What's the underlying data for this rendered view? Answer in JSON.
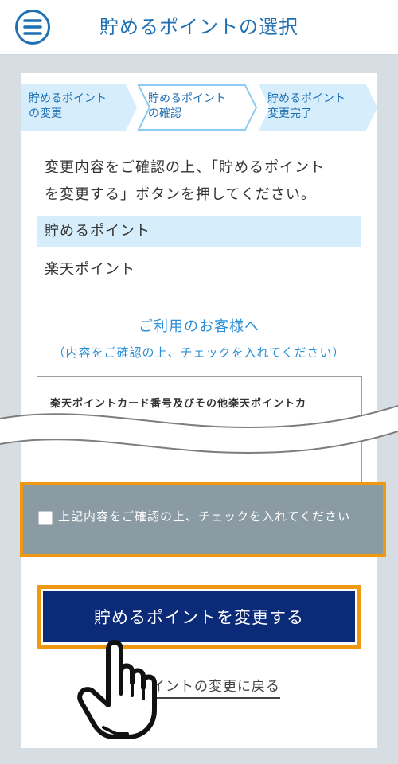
{
  "header": {
    "title": "貯めるポイントの選択",
    "menu_icon": "hamburger-menu-icon"
  },
  "steps": [
    {
      "line1": "貯めるポイント",
      "line2": "の変更",
      "state": "done"
    },
    {
      "line1": "貯めるポイント",
      "line2": "の確認",
      "state": "current"
    },
    {
      "line1": "貯めるポイント",
      "line2": "変更完了",
      "state": "upcoming"
    }
  ],
  "instruction": {
    "line1": "変更内容をご確認の上、「貯めるポイント",
    "line2": "を変更する」ボタンを押してください。"
  },
  "section": {
    "label": "貯めるポイント",
    "value": "楽天ポイント"
  },
  "notice": {
    "title": "ご利用のお客様へ",
    "subtitle": "（内容をご確認の上、チェックを入れてください）"
  },
  "terms": {
    "text": "楽天ポイントカード番号及びその他楽天ポイントカ"
  },
  "agreement": {
    "label": "上記内容をご確認の上、チェックを入れてください",
    "checked": false
  },
  "submit": {
    "label": "貯めるポイントを変更する"
  },
  "back_link": {
    "label": "イントの変更に戻る"
  },
  "colors": {
    "header_title": "#1e6fb3",
    "step_fill": "#d6eefc",
    "highlight_border": "#f0980f",
    "submit_bg": "#0b2a78",
    "checkbox_panel_bg": "#8a9ba3",
    "notice_text": "#2a8fd6"
  }
}
